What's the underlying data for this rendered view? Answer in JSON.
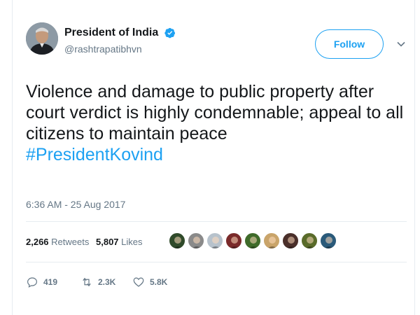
{
  "tweet": {
    "author": {
      "display_name": "President of India",
      "handle": "@rashtrapatibhvn"
    },
    "follow_label": "Follow",
    "text_main": "Violence and damage to public property after court verdict is highly condemnable; appeal to all citizens to maintain peace",
    "hashtag": "#PresidentKovind",
    "timestamp": "6:36 AM - 25 Aug 2017",
    "stats": {
      "retweets_count": "2,266",
      "retweets_label": "Retweets",
      "likes_count": "5,807",
      "likes_label": "Likes"
    },
    "liker_avatars": [
      {
        "color": "#2f4a2a"
      },
      {
        "color": "#8a8a8a"
      },
      {
        "color": "#b7c2cc"
      },
      {
        "color": "#7a2a2a"
      },
      {
        "color": "#3f6b2a"
      },
      {
        "color": "#c9a46a"
      },
      {
        "color": "#4a2f2a"
      },
      {
        "color": "#5a6b2a"
      },
      {
        "color": "#2a5a7a"
      }
    ],
    "actions": {
      "reply_count": "419",
      "retweet_count": "2.3K",
      "like_count": "5.8K"
    }
  },
  "colors": {
    "accent": "#1da1f2",
    "muted_text": "#657786",
    "border": "#e6ecf0"
  },
  "icons": [
    "verified-badge-icon",
    "chevron-down-icon",
    "reply-icon",
    "retweet-icon",
    "heart-icon"
  ]
}
